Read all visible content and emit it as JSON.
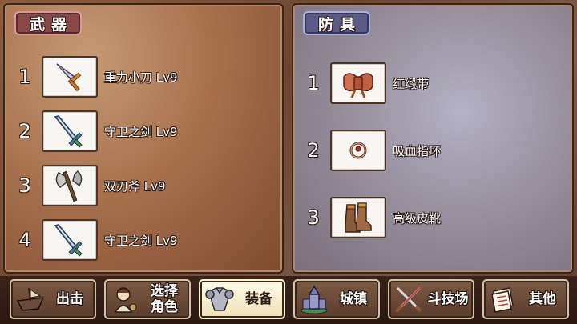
{
  "weapons": {
    "title": "武器",
    "items": [
      {
        "num": "1",
        "name": "重力小刀 Lv9",
        "icon": "dagger-icon"
      },
      {
        "num": "2",
        "name": "守卫之剑 Lv9",
        "icon": "sword-icon"
      },
      {
        "num": "3",
        "name": "双刃斧 Lv9",
        "icon": "double-axe-icon"
      },
      {
        "num": "4",
        "name": "守卫之剑 Lv9",
        "icon": "sword-icon"
      }
    ]
  },
  "armor": {
    "title": "防具",
    "items": [
      {
        "num": "1",
        "name": "红缎带",
        "icon": "ribbon-icon"
      },
      {
        "num": "2",
        "name": "吸血指环",
        "icon": "ring-icon"
      },
      {
        "num": "3",
        "name": "高级皮靴",
        "icon": "boots-icon"
      }
    ]
  },
  "nav": {
    "sortie": "出击",
    "select_character": "选择\n角色",
    "equipment": "装备",
    "town": "城镇",
    "arena": "斗技场",
    "other": "其他"
  },
  "colors": {
    "weapon_panel": "#a8714c",
    "armor_panel": "#98909e",
    "active_tab": "#efe1b8"
  }
}
